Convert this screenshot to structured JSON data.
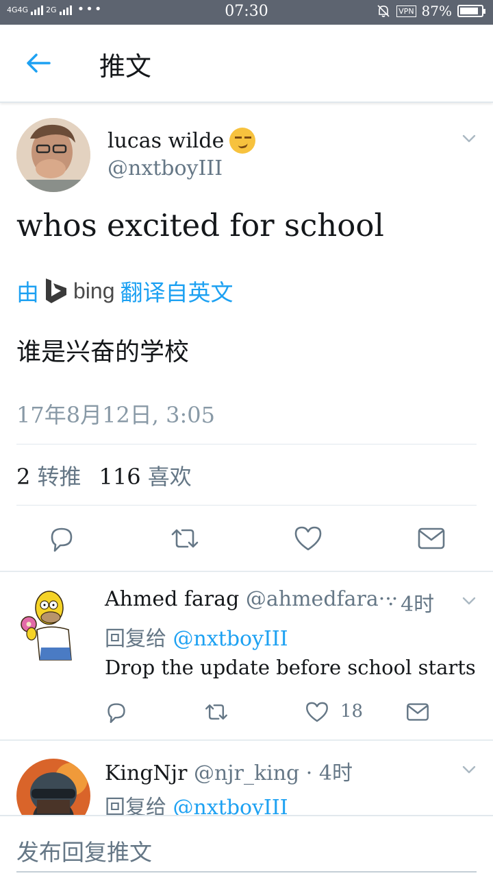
{
  "status_bar": {
    "network_1": "4G4G",
    "network_2": "2G",
    "time": "07:30",
    "vpn": "VPN",
    "battery": "87%",
    "battery_level": 0.87
  },
  "header": {
    "title": "推文"
  },
  "tweet": {
    "name": "lucas wilde",
    "handle": "@nxtboyIII",
    "text": "whos excited for school",
    "translate_prefix": "由",
    "translate_brand": "bing",
    "translate_suffix": "翻译自英文",
    "translated_text": "谁是兴奋的学校",
    "timestamp": "17年8月12日, 3:05",
    "retweets_count": "2",
    "retweets_label": "转推",
    "likes_count": "116",
    "likes_label": "喜欢"
  },
  "replies": [
    {
      "name": "Ahmed farag",
      "handle": "@ahmedfara···",
      "time": "· 4时",
      "reply_prefix": "回复给",
      "reply_to": "@nxtboyIII",
      "text": "Drop the update before school starts",
      "likes": "18"
    },
    {
      "name": "KingNjr",
      "handle": "@njr_king",
      "time": "· 4时",
      "reply_prefix": "回复给",
      "reply_to": "@nxtboyIII"
    }
  ],
  "compose": {
    "placeholder": "发布回复推文"
  },
  "icons": {
    "back": "arrow-left-icon",
    "caret": "chevron-down-icon",
    "reply": "comment-icon",
    "retweet": "retweet-icon",
    "like": "heart-icon",
    "dm": "envelope-icon"
  },
  "colors": {
    "accent": "#1da1f2",
    "status_bar": "#5d6470",
    "secondary_text": "#657786"
  }
}
